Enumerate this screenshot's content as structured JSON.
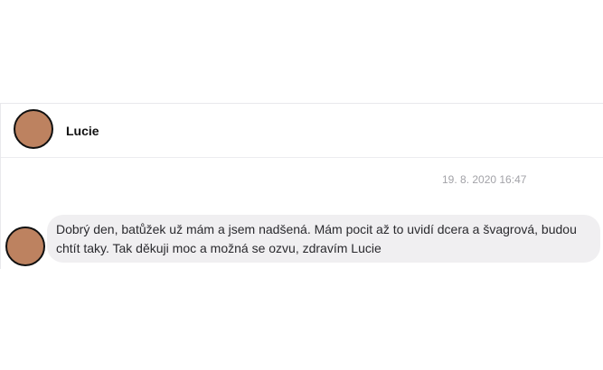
{
  "header": {
    "contact_name": "Lucie"
  },
  "conversation": {
    "timestamp": "19. 8. 2020 16:47",
    "messages": [
      {
        "text": "Dobrý den, batůžek už mám a jsem nadšená. Mám pocit až to uvidí dcera a švagrová, budou chtít taky. Tak děkuji moc a možná se ozvu, zdravím Lucie"
      }
    ]
  },
  "colors": {
    "avatar": "#bd8260",
    "bubble": "#f0eff1",
    "timestamp": "#a3a3a8"
  }
}
